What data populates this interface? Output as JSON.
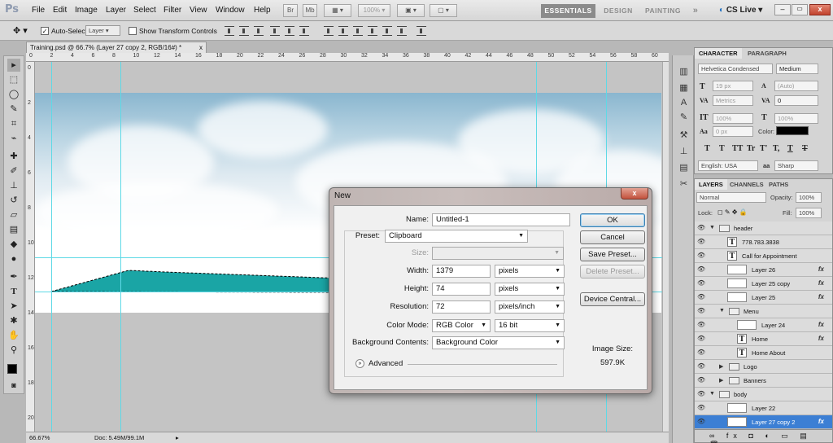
{
  "app": {
    "logo": "Ps"
  },
  "menu": [
    "File",
    "Edit",
    "Image",
    "Layer",
    "Select",
    "Filter",
    "View",
    "Window",
    "Help"
  ],
  "titlebar": {
    "mode_boxes": [
      "Br",
      "Mb"
    ],
    "zoom": "100%",
    "workspaces": {
      "essentials": "ESSENTIALS",
      "design": "DESIGN",
      "painting": "PAINTING",
      "more": "»"
    },
    "cslive": "CS Live"
  },
  "options_bar": {
    "auto_select_label": "Auto-Select:",
    "auto_select_value": "Layer",
    "transform_label": "Show Transform Controls"
  },
  "document": {
    "tab_title": "Training.psd @ 66.7% (Layer 27 copy 2, RGB/16#) *",
    "status_zoom": "66.67%",
    "status_doc": "Doc: 5.49M/99.1M",
    "ruler_top": [
      "0",
      "2",
      "4",
      "6",
      "8",
      "10",
      "12",
      "14",
      "16",
      "18",
      "20",
      "22",
      "24",
      "26",
      "28",
      "30",
      "32",
      "34",
      "36",
      "38",
      "40",
      "42",
      "44",
      "46",
      "48",
      "50",
      "52",
      "54",
      "56",
      "58",
      "60"
    ],
    "ruler_left": [
      "0",
      "2",
      "4",
      "6",
      "8",
      "10",
      "12",
      "14",
      "16",
      "18",
      "20"
    ]
  },
  "character_panel": {
    "tabs": [
      "CHARACTER",
      "PARAGRAPH"
    ],
    "font_family": "Helvetica Condensed",
    "font_style": "Medium",
    "size": "19 px",
    "leading": "(Auto)",
    "kerning": "Metrics",
    "tracking": "0",
    "vscale": "100%",
    "hscale": "100%",
    "baseline": "0 px",
    "color_label": "Color:",
    "glyphs": [
      "T",
      "T",
      "TT",
      "Tr",
      "T'",
      "T,",
      "T",
      "T"
    ],
    "language": "English: USA",
    "aa_symbol": "aa",
    "antialias": "Sharp",
    "color": "#000000"
  },
  "layers_panel": {
    "tabs": [
      "LAYERS",
      "CHANNELS",
      "PATHS"
    ],
    "blend": "Normal",
    "opacity_label": "Opacity:",
    "opacity": "100%",
    "lock_label": "Lock:",
    "fill_label": "Fill:",
    "fill": "100%",
    "fx": "fx",
    "rows": [
      {
        "name": "header",
        "kind": "folder",
        "indent": 0
      },
      {
        "name": "778.783.3838",
        "kind": "text",
        "indent": 1
      },
      {
        "name": "Call for Appointment",
        "kind": "text",
        "indent": 1
      },
      {
        "name": "Layer 26",
        "kind": "pixel",
        "indent": 1,
        "fx": true
      },
      {
        "name": "Layer 25 copy",
        "kind": "pixel",
        "indent": 1,
        "fx": true
      },
      {
        "name": "Layer 25",
        "kind": "pixel",
        "indent": 1,
        "fx": true
      },
      {
        "name": "Menu",
        "kind": "folder",
        "indent": 1
      },
      {
        "name": "Layer 24",
        "kind": "pixel",
        "indent": 2,
        "fx": true
      },
      {
        "name": "Home",
        "kind": "text",
        "indent": 2,
        "fx": true
      },
      {
        "name": "Home          About",
        "kind": "text",
        "indent": 2
      },
      {
        "name": "Logo",
        "kind": "folder",
        "indent": 1
      },
      {
        "name": "Banners",
        "kind": "folder",
        "indent": 1
      },
      {
        "name": "body",
        "kind": "folder",
        "indent": 0
      },
      {
        "name": "Layer 22",
        "kind": "pixel",
        "indent": 1
      },
      {
        "name": "Layer 27 copy 2",
        "kind": "pixel",
        "indent": 1,
        "fx": true,
        "selected": true
      }
    ]
  },
  "dialog": {
    "title": "New",
    "close": "x",
    "name_label": "Name:",
    "name_value": "Untitled-1",
    "preset_label": "Preset:",
    "preset_value": "Clipboard",
    "size_label": "Size:",
    "width_label": "Width:",
    "width_value": "1379",
    "width_unit": "pixels",
    "height_label": "Height:",
    "height_value": "74",
    "height_unit": "pixels",
    "resolution_label": "Resolution:",
    "resolution_value": "72",
    "resolution_unit": "pixels/inch",
    "color_mode_label": "Color Mode:",
    "color_mode_value": "RGB Color",
    "bit_depth": "16 bit",
    "bg_label": "Background Contents:",
    "bg_value": "Background Color",
    "advanced": "Advanced",
    "buttons": {
      "ok": "OK",
      "cancel": "Cancel",
      "save_preset": "Save Preset...",
      "delete_preset": "Delete Preset...",
      "device_central": "Device Central..."
    },
    "image_size_label": "Image Size:",
    "image_size_value": "597.9K"
  },
  "colors": {
    "accent": "#3c7fd4",
    "shape": "#1aa5a5",
    "guide": "#5ed9e6"
  }
}
